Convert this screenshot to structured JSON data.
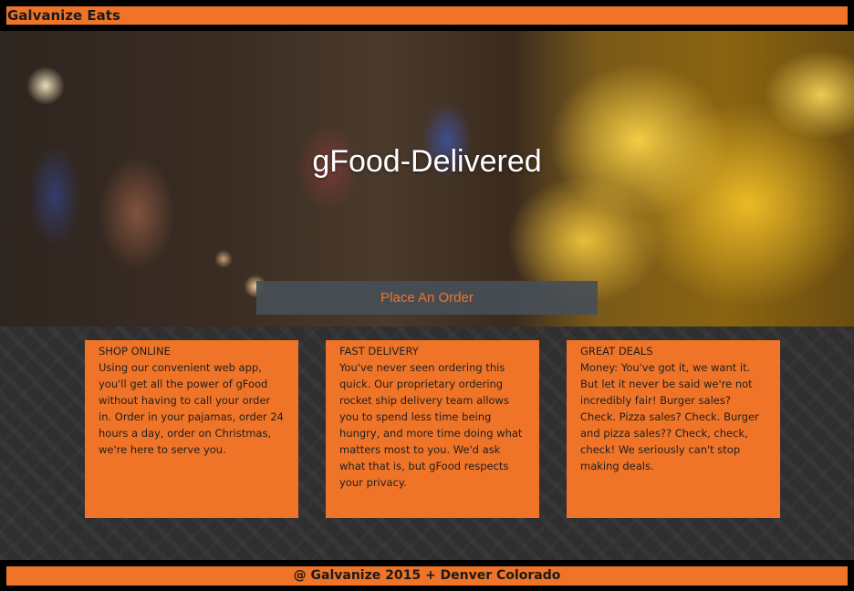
{
  "header": {
    "brand": "Galvanize Eats"
  },
  "hero": {
    "title": "gFood-Delivered",
    "order_button_label": "Place An Order"
  },
  "features": [
    {
      "title": "SHOP ONLINE",
      "body": "Using our convenient web app, you'll get all the power of gFood without having to call your order in. Order in your pajamas, order 24 hours a day, order on Christmas, we're here to serve you."
    },
    {
      "title": "FAST DELIVERY",
      "body": "You've never seen ordering this quick. Our proprietary ordering rocket ship delivery team allows you to spend less time being hungry, and more time doing what matters most to you. We'd ask what that is, but gFood respects your privacy."
    },
    {
      "title": "GREAT DEALS",
      "body": "Money: You've got it, we want it. But let it never be said we're not incredibly fair! Burger sales? Check. Pizza sales? Check. Burger and pizza sales?? Check, check, check! We seriously can't stop making deals."
    }
  ],
  "footer": {
    "text": "@ Galvanize 2015 + Denver Colorado"
  },
  "colors": {
    "accent": "#f07428",
    "button_bg": "#464e56",
    "pattern_bg": "#2f2f2f"
  }
}
